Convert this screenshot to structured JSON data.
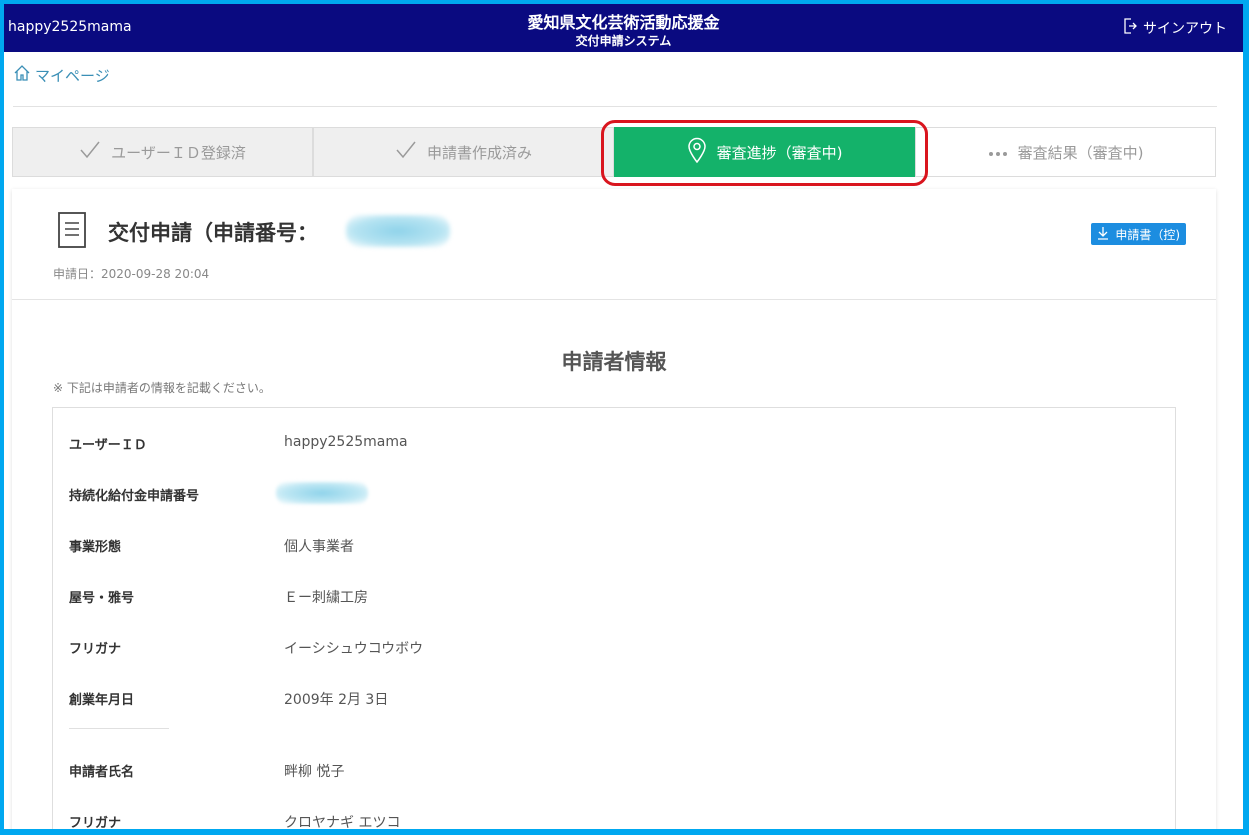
{
  "header": {
    "username": "happy2525mama",
    "title_main": "愛知県文化芸術活動応援金",
    "title_sub": "交付申請システム",
    "signout_label": "サインアウト"
  },
  "breadcrumb": {
    "mypage_label": "マイページ"
  },
  "steps": [
    {
      "label": "ユーザーＩＤ登録済",
      "state": "done",
      "icon": "check-icon"
    },
    {
      "label": "申請書作成済み",
      "state": "done",
      "icon": "check-icon"
    },
    {
      "label": "審査進捗（審査中)",
      "state": "active",
      "icon": "location-pin-icon"
    },
    {
      "label": "審査結果（審査中)",
      "state": "pending",
      "icon": "ellipsis-icon"
    }
  ],
  "application": {
    "title": "交付申請（申請番号：",
    "date": "申請日：2020-09-28 20:04",
    "download_label": "申請書（控)"
  },
  "applicant_section": {
    "title": "申請者情報",
    "note": "※ 下記は申請者の情報を記載ください。",
    "rows": [
      {
        "label": "ユーザーＩＤ",
        "value": "happy2525mama"
      },
      {
        "label": "持続化給付金申請番号",
        "value": ""
      },
      {
        "label": "事業形態",
        "value": "個人事業者"
      },
      {
        "label": "屋号・雅号",
        "value": "Ｅー刺繍工房"
      },
      {
        "label": "フリガナ",
        "value": "イーシシュウコウボウ"
      },
      {
        "label": "創業年月日",
        "value": "2009年 2月 3日"
      },
      {
        "label": "申請者氏名",
        "value": "畔柳 悦子"
      },
      {
        "label": "フリガナ",
        "value": "クロヤナギ エツコ"
      }
    ]
  },
  "colors": {
    "header_bg": "#0a0a80",
    "active_step": "#14b26a",
    "highlight": "#d9151e",
    "link": "#3a8fb6",
    "button": "#1c8de0"
  }
}
